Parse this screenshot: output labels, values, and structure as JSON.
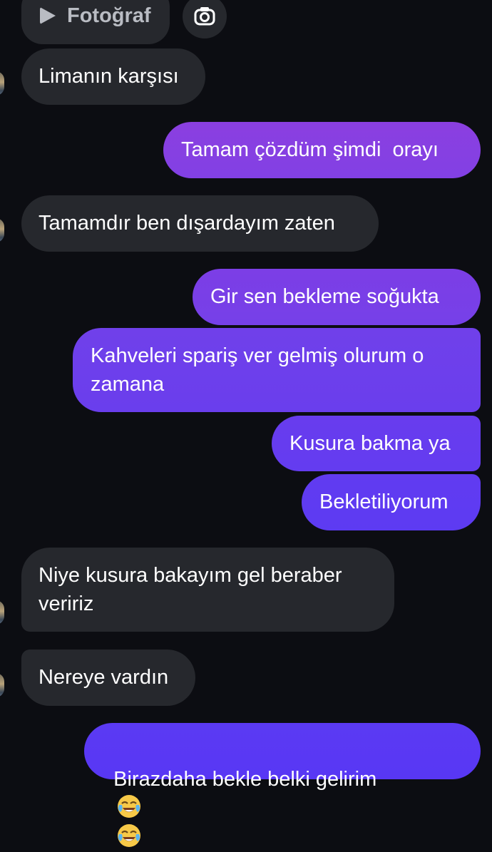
{
  "attachment": {
    "label": "Fotoğraf",
    "play_icon": "play-icon",
    "camera_icon": "camera-icon"
  },
  "messages": [
    {
      "id": 1,
      "from": "other",
      "text": "Limanın karşısı"
    },
    {
      "id": 2,
      "from": "me",
      "text": "Tamam çözdüm şimdi  orayı"
    },
    {
      "id": 3,
      "from": "other",
      "text": "Tamamdır ben dışardayım zaten"
    },
    {
      "id": 4,
      "from": "me",
      "text": "Gir sen bekleme soğukta"
    },
    {
      "id": 5,
      "from": "me",
      "text": "Kahveleri spariş ver gelmiş olurum o zamana"
    },
    {
      "id": 6,
      "from": "me",
      "text": "Kusura bakma ya"
    },
    {
      "id": 7,
      "from": "me",
      "text": "Bekletiliyorum"
    },
    {
      "id": 8,
      "from": "other",
      "text": "Niye kusura bakayım gel beraber veririz"
    },
    {
      "id": 9,
      "from": "other",
      "text": "Nereye vardın"
    },
    {
      "id": 10,
      "from": "me",
      "text": "Birazdaha bekle belki gelirim",
      "emoji": "tears-of-joy-emoji"
    }
  ],
  "colors": {
    "background": "#0c0d12",
    "incoming_bubble": "#26282d",
    "outgoing_gradient_top": "#8a3ee0",
    "outgoing_gradient_bottom": "#5d36f2"
  }
}
